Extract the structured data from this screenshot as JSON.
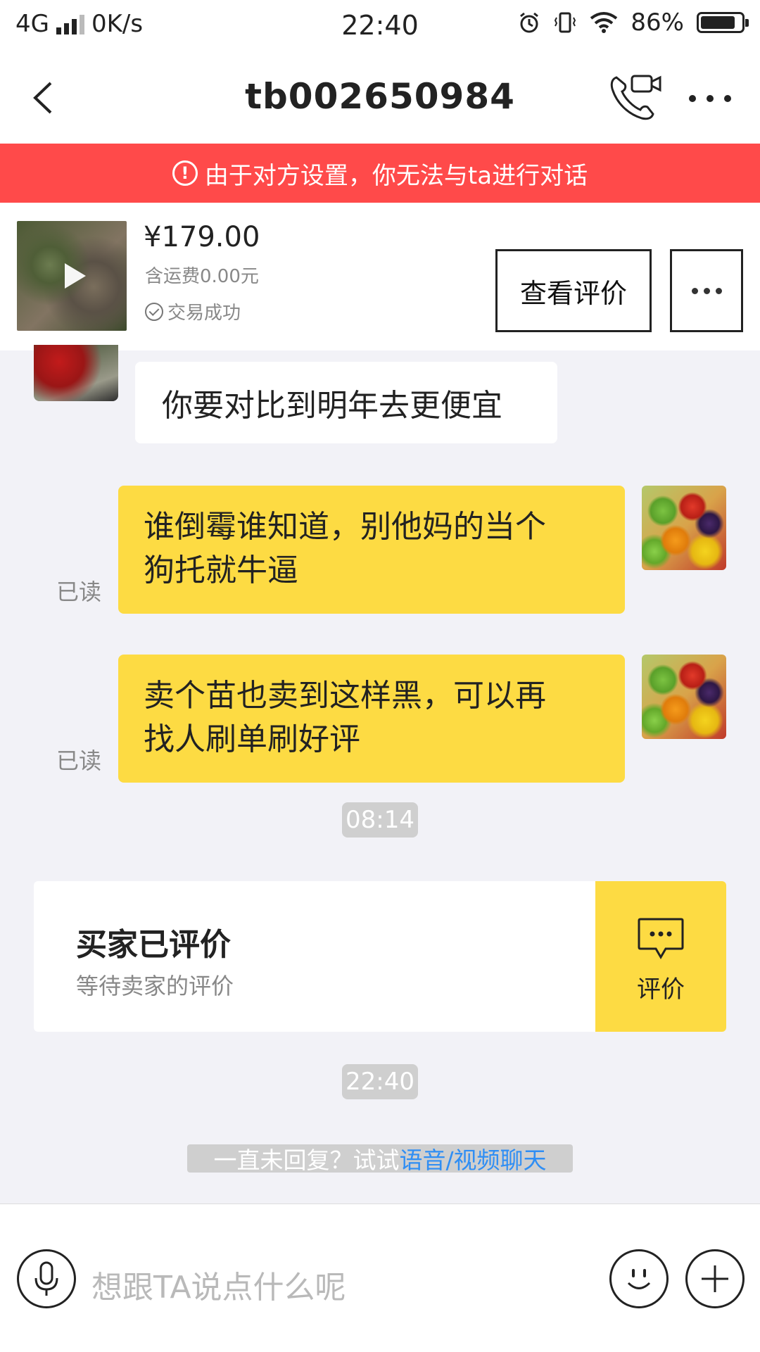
{
  "status_bar": {
    "network": "4G",
    "speed": "0K/s",
    "time": "22:40",
    "battery": "86%",
    "battery_level": 0.86
  },
  "header": {
    "title": "tb002650984"
  },
  "banner": {
    "text": "由于对方设置，你无法与ta进行对话"
  },
  "product": {
    "price": "¥179.00",
    "shipping": "含运费0.00元",
    "status": "交易成功",
    "review_button": "查看评价"
  },
  "messages": [
    {
      "side": "left",
      "text": "你要对比到明年去更便宜"
    },
    {
      "side": "right",
      "line1": "谁倒霉谁知道，别他妈的当个",
      "line2": "狗托就牛逼",
      "read": "已读"
    },
    {
      "side": "right",
      "line1": "卖个苗也卖到这样黑，可以再",
      "line2": "找人刷单刷好评",
      "read": "已读"
    }
  ],
  "timestamps": [
    "08:14",
    "22:40"
  ],
  "rating_card": {
    "title": "买家已评价",
    "subtitle": "等待卖家的评价",
    "button": "评价"
  },
  "hint": {
    "prefix": "一直未回复？试试",
    "link": "语音/视频聊天"
  },
  "input": {
    "placeholder": "想跟TA说点什么呢"
  },
  "colors": {
    "banner": "#ff4a4a",
    "bubble": "#fddb43",
    "link": "#2f8ef4"
  }
}
